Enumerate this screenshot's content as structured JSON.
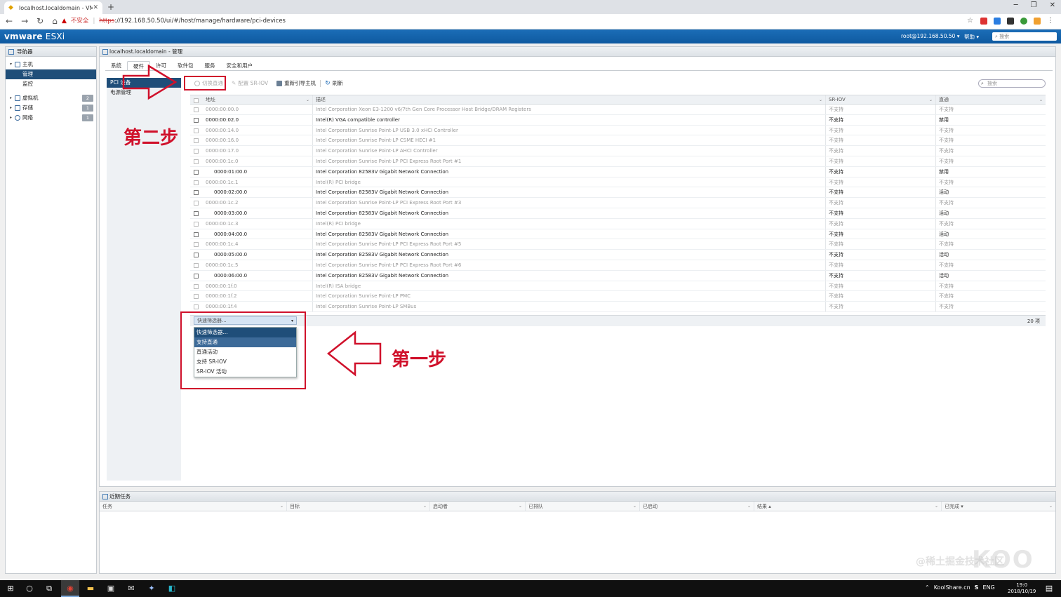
{
  "browser": {
    "tab_title": "localhost.localdomain - VMware",
    "new_tab": "+",
    "url_warning": "不安全",
    "url_scheme": "https",
    "url_rest": "://192.168.50.50/ui/#/host/manage/hardware/pci-devices"
  },
  "esxi": {
    "logo": "vmware",
    "logo_product": "ESXi",
    "user": "root@192.168.50.50 ▾",
    "help": "帮助 ▾",
    "search_placeholder": "搜索"
  },
  "navigator": {
    "title": "导航器",
    "items": [
      {
        "label": "主机"
      },
      {
        "label": "管理"
      },
      {
        "label": "监控"
      },
      {
        "label": "虚拟机",
        "badge": "2"
      },
      {
        "label": "存储",
        "badge": "1"
      },
      {
        "label": "网络",
        "badge": "1"
      }
    ]
  },
  "main": {
    "title": "localhost.localdomain - 管理",
    "tabs": [
      "系统",
      "硬件",
      "许可",
      "软件包",
      "服务",
      "安全和用户"
    ],
    "subnav": [
      "PCI 设备",
      "电源管理"
    ],
    "toolbar": {
      "toggle_passthrough": "切换直通",
      "configure_sriov": "配置 SR-IOV",
      "reboot_host": "重新引导主机",
      "refresh": "刷新"
    },
    "search_placeholder": "搜索",
    "columns": [
      "地址",
      "描述",
      "SR-IOV",
      "直通"
    ],
    "rows": [
      {
        "addr": "0000:00:00.0",
        "desc": "Intel Corporation Xeon E3-1200 v6/7th Gen Core Processor Host Bridge/DRAM Registers",
        "sriov": "不支持",
        "pt": "不支持"
      },
      {
        "addr": "0000:00:02.0",
        "desc": "Intel(R) VGA compatible controller",
        "sriov": "不支持",
        "pt": "禁用"
      },
      {
        "addr": "0000:00:14.0",
        "desc": "Intel Corporation Sunrise Point-LP USB 3.0 xHCI Controller",
        "sriov": "不支持",
        "pt": "不支持"
      },
      {
        "addr": "0000:00:16.0",
        "desc": "Intel Corporation Sunrise Point-LP CSME HECI #1",
        "sriov": "不支持",
        "pt": "不支持"
      },
      {
        "addr": "0000:00:17.0",
        "desc": "Intel Corporation Sunrise Point-LP AHCI Controller",
        "sriov": "不支持",
        "pt": "不支持"
      },
      {
        "addr": "0000:00:1c.0",
        "desc": "Intel Corporation Sunrise Point-LP PCI Express Root Port #1",
        "sriov": "不支持",
        "pt": "不支持"
      },
      {
        "addr": "0000:01:00.0",
        "desc": "Intel Corporation 82583V Gigabit Network Connection",
        "sriov": "不支持",
        "pt": "禁用"
      },
      {
        "addr": "0000:00:1c.1",
        "desc": "Intel(R) PCI bridge",
        "sriov": "不支持",
        "pt": "不支持"
      },
      {
        "addr": "0000:02:00.0",
        "desc": "Intel Corporation 82583V Gigabit Network Connection",
        "sriov": "不支持",
        "pt": "活动"
      },
      {
        "addr": "0000:00:1c.2",
        "desc": "Intel Corporation Sunrise Point-LP PCI Express Root Port #3",
        "sriov": "不支持",
        "pt": "不支持"
      },
      {
        "addr": "0000:03:00.0",
        "desc": "Intel Corporation 82583V Gigabit Network Connection",
        "sriov": "不支持",
        "pt": "活动"
      },
      {
        "addr": "0000:00:1c.3",
        "desc": "Intel(R) PCI bridge",
        "sriov": "不支持",
        "pt": "不支持"
      },
      {
        "addr": "0000:04:00.0",
        "desc": "Intel Corporation 82583V Gigabit Network Connection",
        "sriov": "不支持",
        "pt": "活动"
      },
      {
        "addr": "0000:00:1c.4",
        "desc": "Intel Corporation Sunrise Point-LP PCI Express Root Port #5",
        "sriov": "不支持",
        "pt": "不支持"
      },
      {
        "addr": "0000:05:00.0",
        "desc": "Intel Corporation 82583V Gigabit Network Connection",
        "sriov": "不支持",
        "pt": "活动"
      },
      {
        "addr": "0000:00:1c.5",
        "desc": "Intel Corporation Sunrise Point-LP PCI Express Root Port #6",
        "sriov": "不支持",
        "pt": "不支持"
      },
      {
        "addr": "0000:06:00.0",
        "desc": "Intel Corporation 82583V Gigabit Network Connection",
        "sriov": "不支持",
        "pt": "活动"
      },
      {
        "addr": "0000:00:1f.0",
        "desc": "Intel(R) ISA bridge",
        "sriov": "不支持",
        "pt": "不支持"
      },
      {
        "addr": "0000:00:1f.2",
        "desc": "Intel Corporation Sunrise Point-LP PMC",
        "sriov": "不支持",
        "pt": "不支持"
      },
      {
        "addr": "0000:00:1f.4",
        "desc": "Intel Corporation Sunrise Point-LP SMBus",
        "sriov": "不支持",
        "pt": "不支持"
      }
    ],
    "item_count": "20 项",
    "filter": {
      "selected": "快速筛选器...",
      "options": [
        "快速筛选器...",
        "支持直通",
        "直通活动",
        "支持 SR-IOV",
        "SR-IOV 活动"
      ]
    }
  },
  "annotations": {
    "step2": "第二步",
    "step1": "第一步",
    "color": "#d0112b"
  },
  "tasks": {
    "title": "近期任务",
    "columns": [
      "任务",
      "目标",
      "启动者",
      "已排队",
      "已启动",
      "结果 ▴",
      "已完成 ▾"
    ]
  },
  "taskbar": {
    "tray_text": "KoolShare.cn",
    "ime": "S",
    "lang": "ENG",
    "time": "19:0",
    "date": "2018/10/19"
  },
  "watermark": "@稀土掘金技术社区"
}
